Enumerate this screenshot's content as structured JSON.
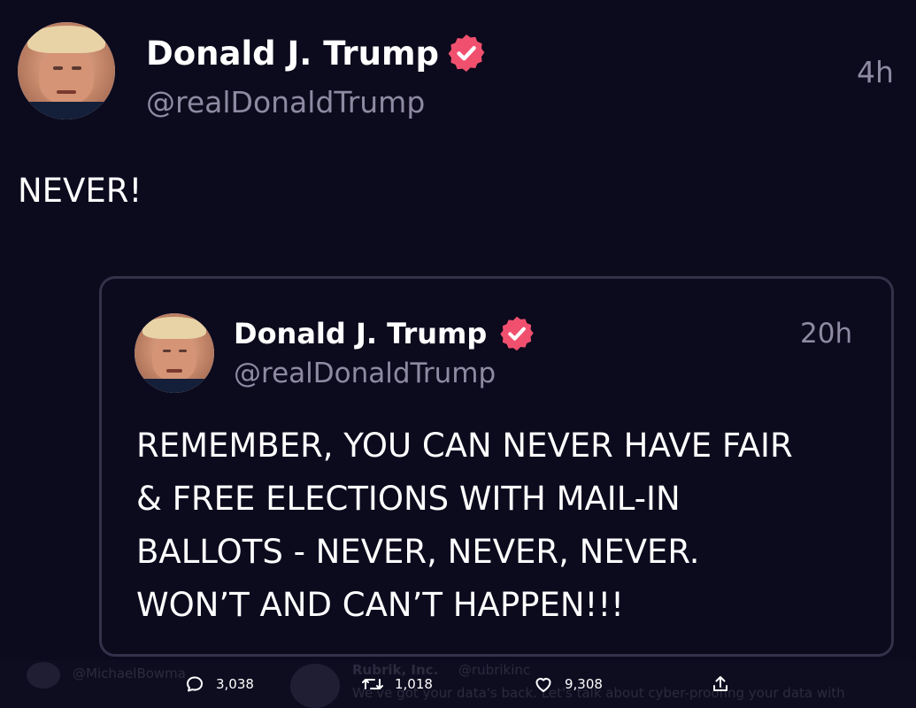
{
  "tweet": {
    "author_name": "Donald J. Trump",
    "author_handle": "@realDonaldTrump",
    "time": "4h",
    "text": "NEVER!"
  },
  "quoted_tweet": {
    "author_name": "Donald J. Trump",
    "author_handle": "@realDonaldTrump",
    "time": "20h",
    "text_lines": [
      "REMEMBER, YOU CAN NEVER HAVE FAIR",
      "& FREE ELECTIONS WITH MAIL-IN",
      "BALLOTS - NEVER, NEVER, NEVER.",
      "WON’T AND CAN’T HAPPEN!!!"
    ]
  },
  "background_feed": {
    "left_handle": "@MichaelBowma",
    "ad_name": "Rubrik, Inc.",
    "ad_handle": "@rubrikinc",
    "ad_text": "We've got your data's back. Let's talk about cyber-proofing your data with"
  },
  "actions": {
    "replies": "3,038",
    "retweets": "1,018",
    "likes": "9,308"
  },
  "colors": {
    "background": "#0c0a1d",
    "verified_badge": "#f0506e",
    "secondary_text": "#8e8aa2",
    "card_border": "#35314a"
  },
  "icons": {
    "verified": "verified-badge-icon",
    "reply": "reply-icon",
    "retweet": "retweet-icon",
    "like": "heart-icon",
    "share": "share-icon"
  }
}
